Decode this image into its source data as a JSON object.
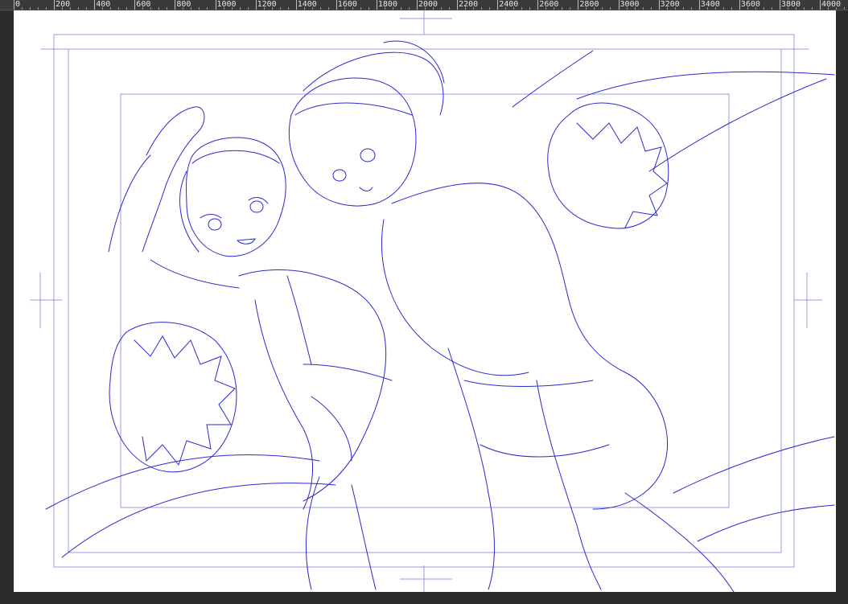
{
  "ruler": {
    "labels": [
      "0",
      "200",
      "400",
      "600",
      "800",
      "1000",
      "1200",
      "1400",
      "1600",
      "1800",
      "2000",
      "2200",
      "2400",
      "2600",
      "2800",
      "3000",
      "3200",
      "3400",
      "3600",
      "3800",
      "4000"
    ]
  },
  "canvas": {
    "background": "#ffffff",
    "stroke_color": "#2a2ad0",
    "guide_color": "#8a8ad8"
  }
}
